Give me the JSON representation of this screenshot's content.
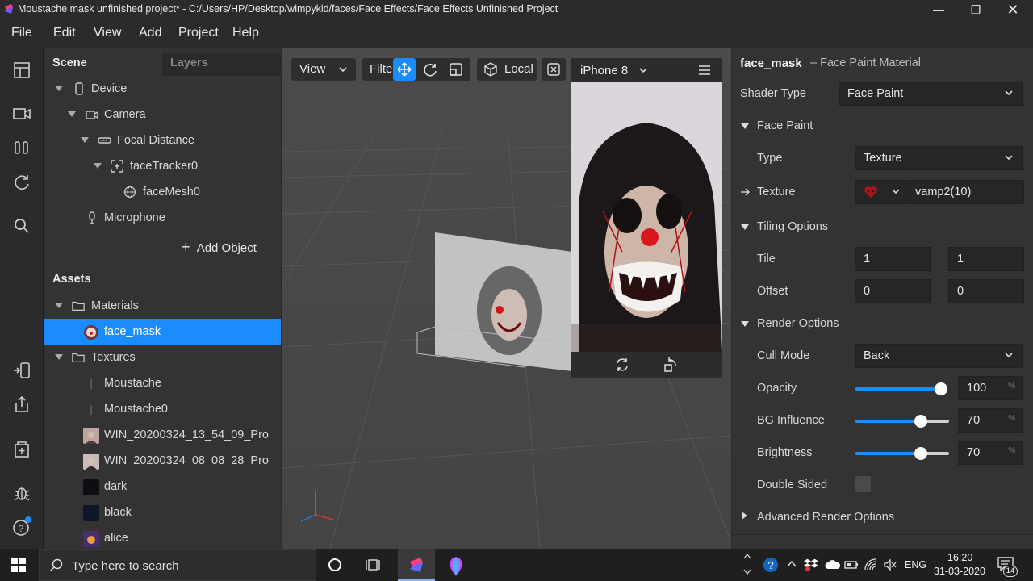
{
  "window": {
    "title": "Moustache mask unfinished project* - C:/Users/HP/Desktop/wimpykid/faces/Face Effects/Face Effects Unfinished Project"
  },
  "menu": [
    "File",
    "Edit",
    "View",
    "Add",
    "Project",
    "Help"
  ],
  "scene_panel": {
    "tab_scene": "Scene",
    "tab_layers": "Layers",
    "tree": [
      {
        "label": "Device",
        "icon": "phone-icon"
      },
      {
        "label": "Camera",
        "icon": "camera-icon"
      },
      {
        "label": "Focal Distance",
        "icon": "focal-distance-icon"
      },
      {
        "label": "faceTracker0",
        "icon": "face-tracker-icon"
      },
      {
        "label": "faceMesh0",
        "icon": "mesh-icon"
      },
      {
        "label": "Microphone",
        "icon": "microphone-icon"
      }
    ],
    "add_object": "Add Object"
  },
  "assets_panel": {
    "title": "Assets",
    "items": [
      {
        "label": "Materials",
        "icon": "folder-icon"
      },
      {
        "label": "face_mask",
        "icon": "material-thumb",
        "selected": true
      },
      {
        "label": "Textures",
        "icon": "folder-icon"
      },
      {
        "label": "Moustache",
        "icon": "moustache-thumb"
      },
      {
        "label": "Moustache0",
        "icon": "moustache-thumb"
      },
      {
        "label": "WIN_20200324_13_54_09_Pro",
        "icon": "photo-thumb"
      },
      {
        "label": "WIN_20200324_08_08_28_Pro",
        "icon": "photo-thumb"
      },
      {
        "label": "dark",
        "icon": "dark-thumb"
      },
      {
        "label": "black",
        "icon": "black-thumb"
      },
      {
        "label": "alice",
        "icon": "alice-thumb"
      }
    ]
  },
  "viewport": {
    "view_label": "View",
    "filter_label": "Filte",
    "local_label": "Local",
    "device_label": "iPhone 8"
  },
  "properties": {
    "object_name": "face_mask",
    "object_type": "– Face Paint Material",
    "shader_type_label": "Shader Type",
    "shader_type_value": "Face Paint",
    "face_paint_section": "Face Paint",
    "type_label": "Type",
    "type_value": "Texture",
    "texture_label": "Texture",
    "texture_value": "vamp2(10)",
    "tiling_section": "Tiling Options",
    "tile_label": "Tile",
    "tile_x": "1",
    "tile_y": "1",
    "offset_label": "Offset",
    "offset_x": "0",
    "offset_y": "0",
    "render_section": "Render Options",
    "cull_mode_label": "Cull Mode",
    "cull_mode_value": "Back",
    "opacity_label": "Opacity",
    "opacity_value": "100",
    "opacity_fraction": 1.0,
    "bg_influence_label": "BG Influence",
    "bg_influence_value": "70",
    "bg_influence_fraction": 0.7,
    "brightness_label": "Brightness",
    "brightness_value": "70",
    "brightness_fraction": 0.7,
    "percent_symbol": "%",
    "double_sided_label": "Double Sided",
    "advanced_section": "Advanced Render Options"
  },
  "taskbar": {
    "search_placeholder": "Type here to search",
    "language": "ENG",
    "time": "16:20",
    "date": "31-03-2020",
    "notification_count": "14"
  },
  "colors": {
    "accent": "#1a8cff",
    "panel": "#333333",
    "viewport": "#4a4a4a"
  }
}
